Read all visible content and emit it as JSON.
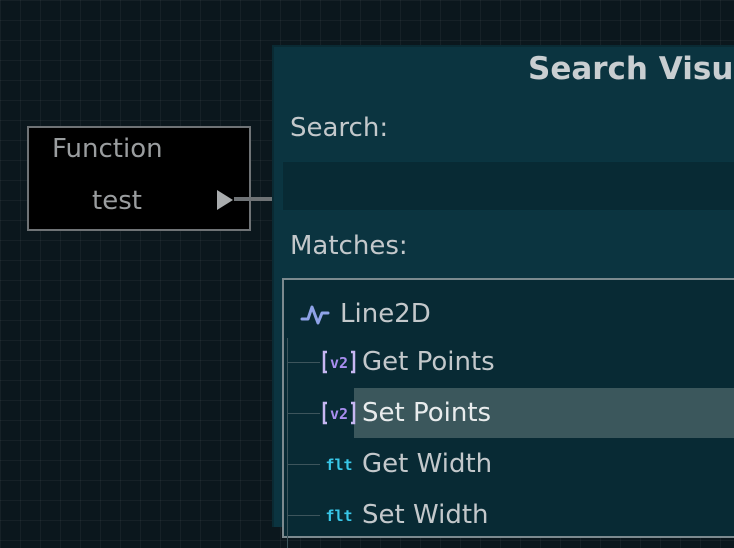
{
  "graph": {
    "node": {
      "type_label": "Function",
      "name": "test"
    }
  },
  "dialog": {
    "title": "Search Visual",
    "search_label": "Search:",
    "search_value": "",
    "matches_label": "Matches:",
    "tree": {
      "root": {
        "label": "Line2D",
        "icon": "line-chart-icon"
      },
      "children": [
        {
          "label": "Get Points",
          "icon": "vector2-type-icon",
          "selected": false
        },
        {
          "label": "Set Points",
          "icon": "vector2-type-icon",
          "selected": true
        },
        {
          "label": "Get Width",
          "icon": "float-type-icon",
          "selected": false
        },
        {
          "label": "Set Width",
          "icon": "float-type-icon",
          "selected": false
        }
      ]
    }
  },
  "colors": {
    "vector2_icon": "#a88ef0",
    "float_icon": "#38c7e8",
    "selection": "#3b575c"
  }
}
